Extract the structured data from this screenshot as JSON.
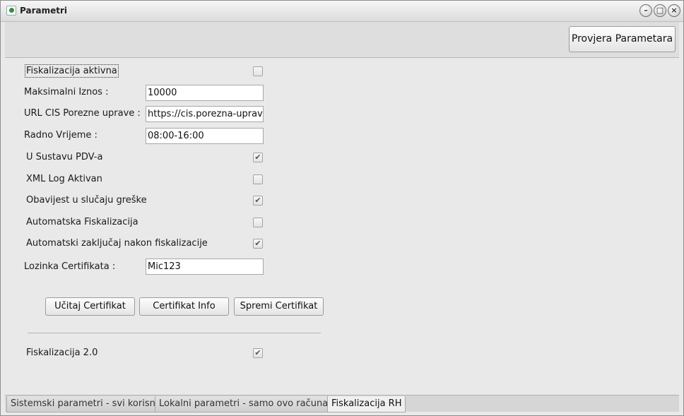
{
  "window": {
    "title": "Parametri",
    "controls": {
      "minimize": "–",
      "maximize": "□",
      "close": "×"
    }
  },
  "toolbar": {
    "verify_label": "Provjera Parametara"
  },
  "form": {
    "fisk_active_label": "Fiskalizacija aktivna",
    "fisk_active_checked": false,
    "max_amount_label": "Maksimalni Iznos :",
    "max_amount_value": "10000",
    "url_label": "URL CIS Porezne uprave :",
    "url_value": "https://cis.porezna-uprava",
    "hours_label": "Radno Vrijeme :",
    "hours_value": "08:00-16:00",
    "pdv_label": "U Sustavu PDV-a",
    "pdv_checked": true,
    "xml_log_label": "XML Log Aktivan",
    "xml_log_checked": false,
    "notify_label": "Obavijest u slučaju greške",
    "notify_checked": true,
    "auto_fisk_label": "Automatska Fiskalizacija",
    "auto_fisk_checked": false,
    "auto_lock_label": "Automatski zaključaj nakon fiskalizacije",
    "auto_lock_checked": true,
    "cert_pass_label": "Lozinka Certifikata :",
    "cert_pass_value": "Mic123",
    "fisk2_label": "Fiskalizacija 2.0",
    "fisk2_checked": true
  },
  "buttons": {
    "load_cert": "Učitaj Certifikat",
    "cert_info": "Certifikat Info",
    "save_cert": "Spremi Certifikat"
  },
  "check_glyph": "✔",
  "tabs": [
    {
      "label": "Sistemski parametri - svi korisnici",
      "active": false
    },
    {
      "label": "Lokalni parametri - samo ovo računalo",
      "active": false
    },
    {
      "label": "Fiskalizacija RH",
      "active": true
    }
  ]
}
